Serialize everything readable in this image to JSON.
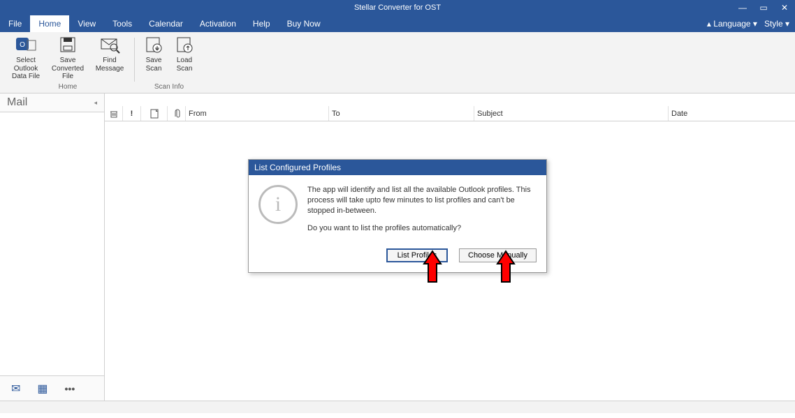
{
  "titlebar": {
    "title": "Stellar Converter for OST"
  },
  "menubar": {
    "tabs": [
      "File",
      "Home",
      "View",
      "Tools",
      "Calendar",
      "Activation",
      "Help",
      "Buy Now"
    ],
    "active_index": 1,
    "right": {
      "language": "Language",
      "style": "Style"
    }
  },
  "ribbon": {
    "home": {
      "buttons": [
        {
          "label": "Select Outlook Data File"
        },
        {
          "label": "Save Converted File"
        },
        {
          "label": "Find Message"
        }
      ],
      "group_label": "Home"
    },
    "scaninfo": {
      "buttons": [
        {
          "label": "Save Scan"
        },
        {
          "label": "Load Scan"
        }
      ],
      "group_label": "Scan Info"
    }
  },
  "sidebar": {
    "header": "Mail"
  },
  "columns": {
    "from": "From",
    "to": "To",
    "subject": "Subject",
    "date": "Date"
  },
  "dialog": {
    "title": "List Configured Profiles",
    "line1": "The app will identify and list all the available Outlook profiles. This process will take upto few minutes to list profiles and can't be stopped in-between.",
    "line2": "Do you want to list the profiles automatically?",
    "btn_primary": "List Profiles",
    "btn_secondary": "Choose Manually"
  }
}
